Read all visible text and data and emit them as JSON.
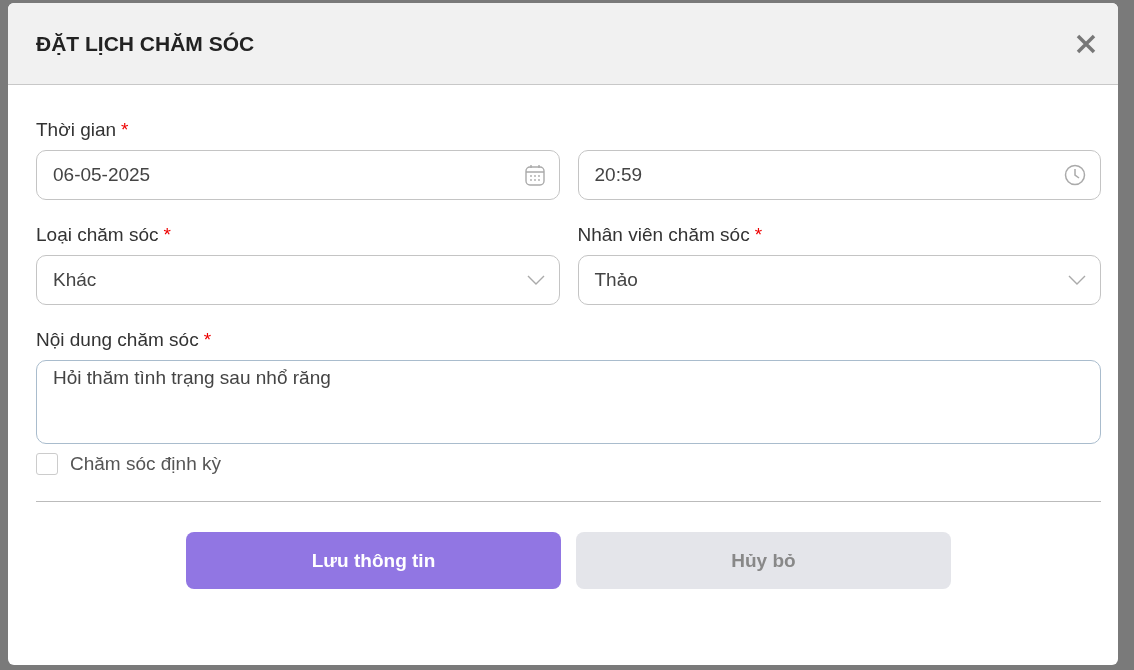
{
  "dialog": {
    "title": "ĐẶT LỊCH CHĂM SÓC"
  },
  "rows": [
    {
      "fields": [
        {
          "kind": "date",
          "label": "Thời gian",
          "required": "*",
          "value": "06-05-2025"
        },
        {
          "kind": "time",
          "value": "20:59"
        }
      ]
    },
    {
      "fields": [
        {
          "kind": "select",
          "label": "Loại chăm sóc",
          "required": "*",
          "value": "Khác"
        },
        {
          "kind": "select",
          "label": "Nhân viên chăm sóc",
          "required": "*",
          "value": "Thảo"
        }
      ]
    },
    {
      "fields": [
        {
          "kind": "textarea",
          "label": "Nội dung chăm sóc",
          "required": "*",
          "value": "Hỏi thăm tình trạng sau nhổ răng"
        }
      ]
    }
  ],
  "periodic": {
    "label": "Chăm sóc định kỳ",
    "checked": false
  },
  "buttons": [
    {
      "kind": "primary",
      "label": "Lưu thông tin"
    },
    {
      "kind": "secondary",
      "label": "Hủy bỏ"
    }
  ]
}
